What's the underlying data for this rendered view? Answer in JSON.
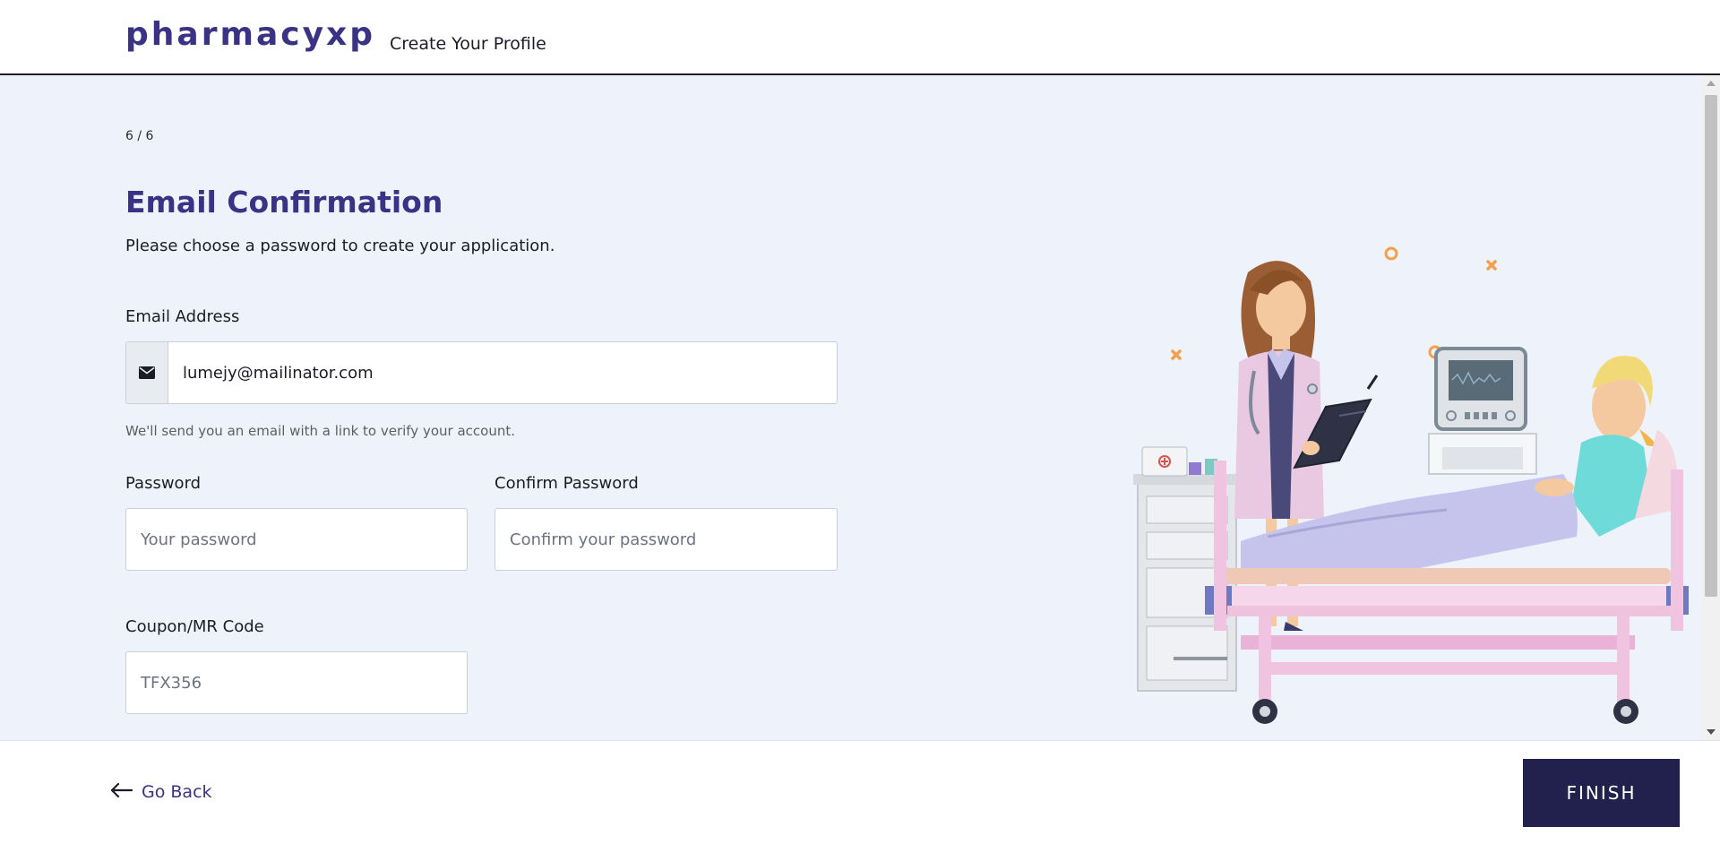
{
  "header": {
    "logo": "pharmacyxp",
    "title": "Create Your Profile"
  },
  "form": {
    "step": "6 / 6",
    "title": "Email Confirmation",
    "subtitle": "Please choose a password to create your application.",
    "email": {
      "label": "Email Address",
      "value": "lumejy@mailinator.com",
      "icon": "envelope-icon",
      "hint": "We'll send you an email with a link to verify your account."
    },
    "password": {
      "label": "Password",
      "placeholder": "Your password"
    },
    "confirm_password": {
      "label": "Confirm Password",
      "placeholder": "Confirm your password"
    },
    "coupon": {
      "label": "Coupon/MR Code",
      "placeholder": "TFX356"
    }
  },
  "footer": {
    "back_label": "Go Back",
    "back_icon": "arrow-left-icon",
    "finish_label": "FINISH"
  },
  "colors": {
    "brand": "#3a3285",
    "button": "#22204d",
    "background": "#eef3fb"
  }
}
